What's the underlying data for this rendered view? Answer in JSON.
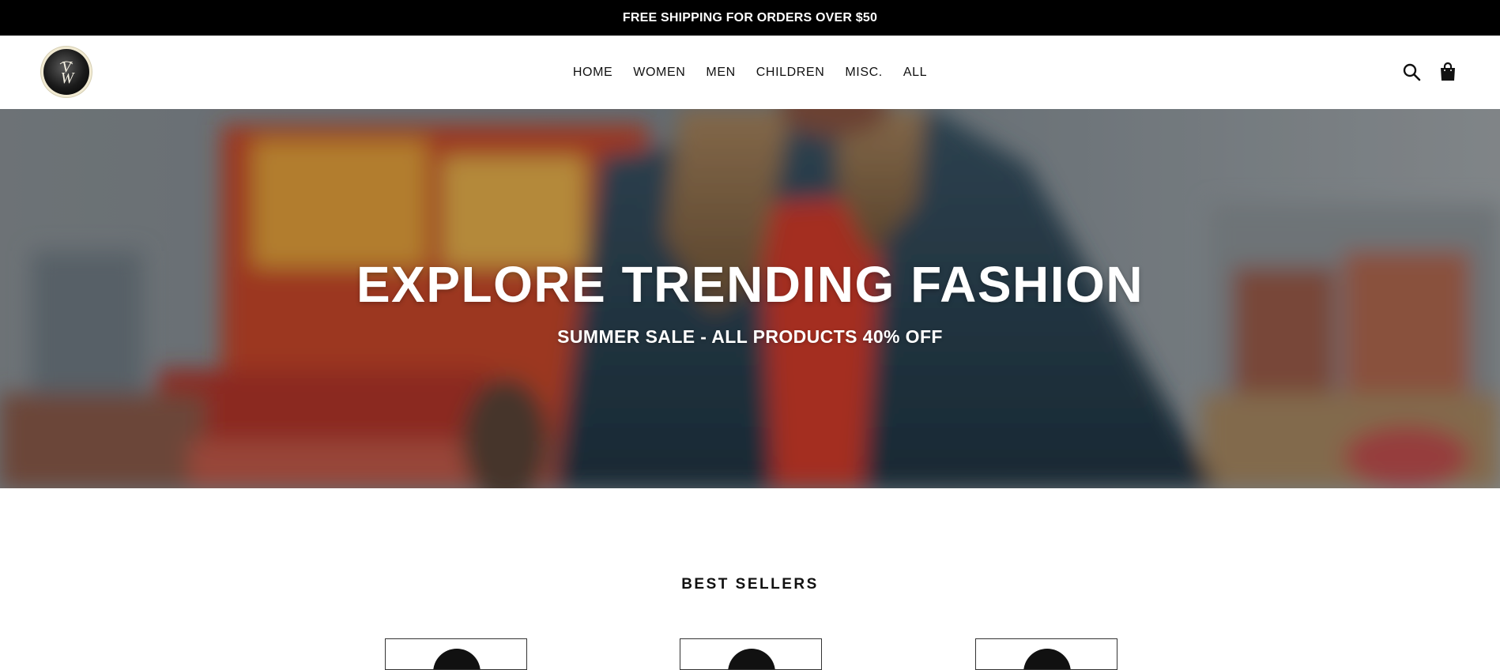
{
  "announcement": {
    "text": "FREE SHIPPING FOR ORDERS OVER $50"
  },
  "header": {
    "logo_text": "VW",
    "nav": [
      {
        "label": "HOME"
      },
      {
        "label": "WOMEN"
      },
      {
        "label": "MEN"
      },
      {
        "label": "CHILDREN"
      },
      {
        "label": "MISC."
      },
      {
        "label": "ALL"
      }
    ],
    "icons": {
      "search": "search-icon",
      "cart": "shopping-bag-icon"
    }
  },
  "hero": {
    "title": "EXPLORE TRENDING FASHION",
    "subtitle": "SUMMER SALE - ALL PRODUCTS 40% OFF"
  },
  "best_sellers": {
    "title": "BEST SELLERS",
    "products": [
      {
        "name": ""
      },
      {
        "name": ""
      },
      {
        "name": ""
      }
    ]
  },
  "colors": {
    "announcement_bg": "#000000",
    "text": "#111111",
    "hero_text": "#ffffff"
  }
}
